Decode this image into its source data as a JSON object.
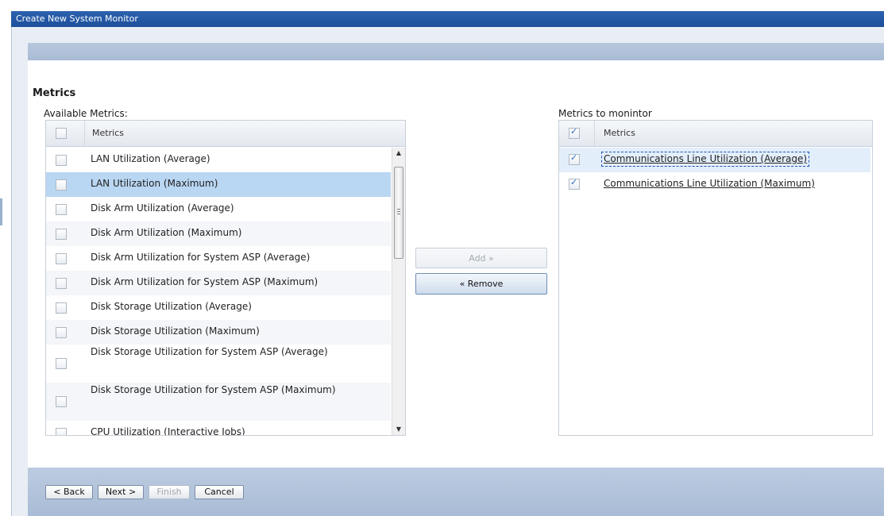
{
  "dialog": {
    "title": "Create New System Monitor"
  },
  "section": {
    "title": "Metrics",
    "available_label": "Available Metrics:",
    "monitor_label": "Metrics to monintor"
  },
  "available": {
    "header": "Metrics",
    "rows": [
      {
        "label": "LAN Utilization (Average)",
        "selected": false
      },
      {
        "label": "LAN Utilization (Maximum)",
        "selected": true
      },
      {
        "label": "Disk Arm Utilization (Average)",
        "selected": false
      },
      {
        "label": "Disk Arm Utilization (Maximum)",
        "selected": false
      },
      {
        "label": "Disk Arm Utilization for System ASP (Average)",
        "selected": false
      },
      {
        "label": "Disk Arm Utilization for System ASP (Maximum)",
        "selected": false
      },
      {
        "label": "Disk Storage Utilization (Average)",
        "selected": false
      },
      {
        "label": "Disk Storage Utilization (Maximum)",
        "selected": false
      },
      {
        "label": "Disk Storage Utilization for System ASP (Average)",
        "selected": false
      },
      {
        "label": "Disk Storage Utilization for System ASP (Maximum)",
        "selected": false
      },
      {
        "label": "CPU Utilization (Interactive Jobs)",
        "selected": false
      }
    ]
  },
  "monitored": {
    "header": "Metrics",
    "rows": [
      {
        "label": "Communications Line Utilization (Average)",
        "checked": true
      },
      {
        "label": "Communications Line Utilization (Maximum)",
        "checked": true
      }
    ]
  },
  "actions": {
    "add": "Add  »",
    "remove": "«  Remove"
  },
  "footer": {
    "back": "< Back",
    "next": "Next >",
    "finish": "Finish",
    "cancel": "Cancel"
  }
}
